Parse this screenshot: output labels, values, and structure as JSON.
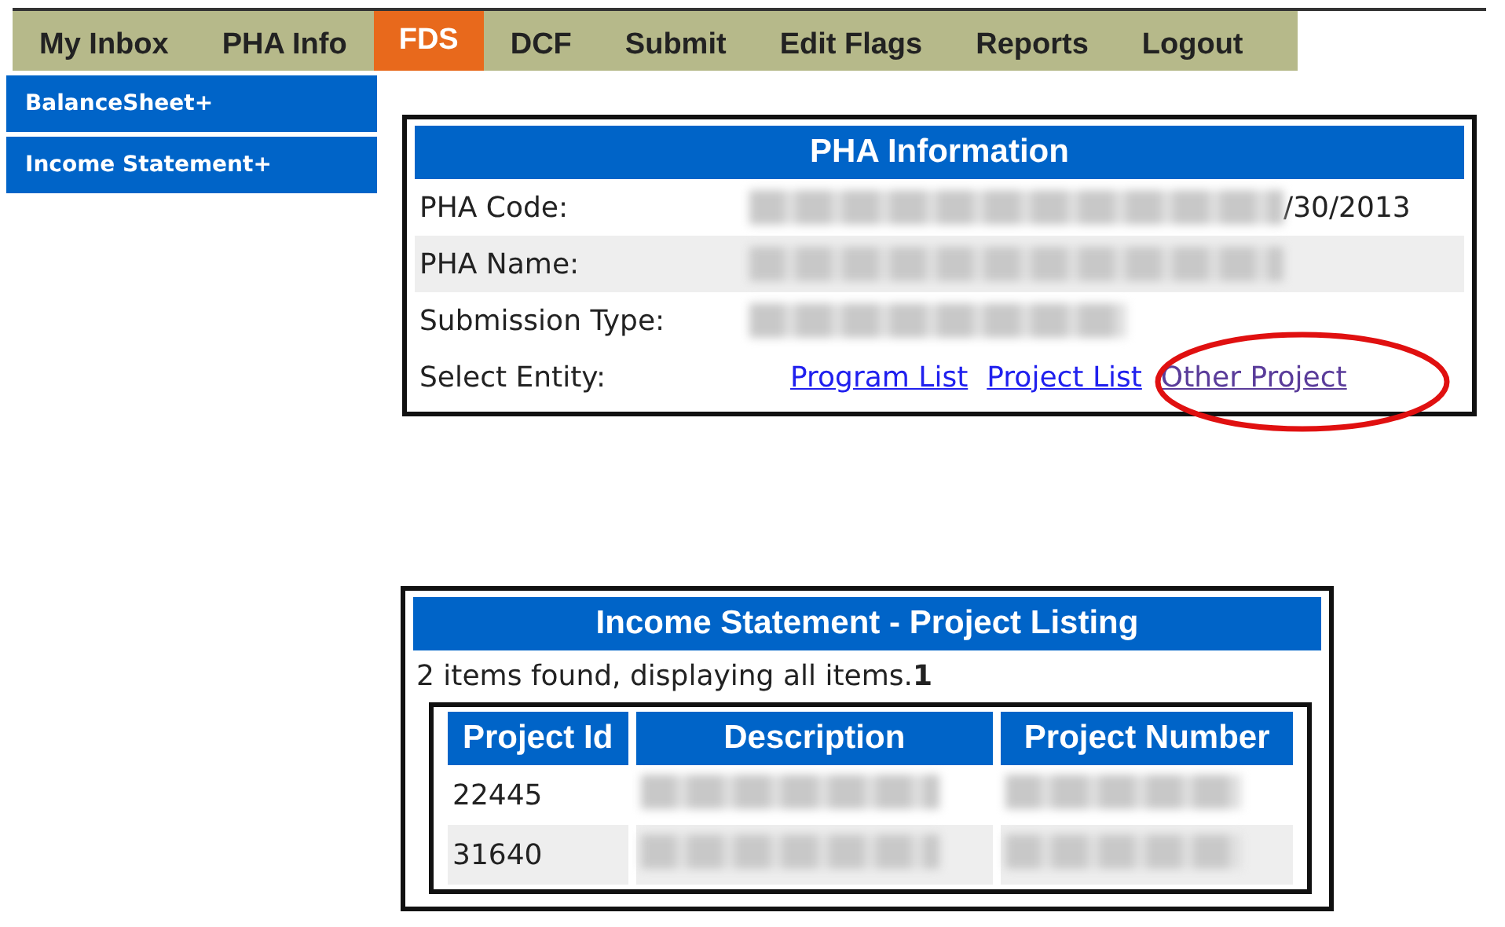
{
  "nav_tabs": [
    {
      "label": "My Inbox",
      "selected": false
    },
    {
      "label": "PHA Info",
      "selected": false
    },
    {
      "label": "FDS",
      "selected": true
    },
    {
      "label": "DCF",
      "selected": false
    },
    {
      "label": "Submit",
      "selected": false
    },
    {
      "label": "Edit Flags",
      "selected": false
    },
    {
      "label": "Reports",
      "selected": false
    },
    {
      "label": "Logout",
      "selected": false
    }
  ],
  "sidebar": {
    "items": [
      "BalanceSheet+",
      "Income Statement+"
    ]
  },
  "pha_information": {
    "title": "PHA Information",
    "rows": [
      {
        "label": "PHA Code:",
        "redacted": true,
        "value": "/30/2013"
      },
      {
        "label": "PHA Name:",
        "redacted": true
      },
      {
        "label": "Submission Type:",
        "redacted": true
      }
    ],
    "select_entity": {
      "label": "Select Entity:",
      "links": [
        {
          "text": "Program List",
          "highlighted": false
        },
        {
          "text": "Project List",
          "highlighted": false
        },
        {
          "text": "Other Project",
          "highlighted": true
        }
      ]
    }
  },
  "project_listing": {
    "title": "Income Statement - Project Listing",
    "summary": "2 items found, displaying all items.**1**",
    "columns": [
      "Project Id",
      "Description",
      "Project Number"
    ],
    "rows": [
      {
        "project_id": "22445",
        "description_redacted": true,
        "number_redacted": true
      },
      {
        "project_id": "31640",
        "description_redacted": true,
        "number_redacted": true
      }
    ]
  }
}
